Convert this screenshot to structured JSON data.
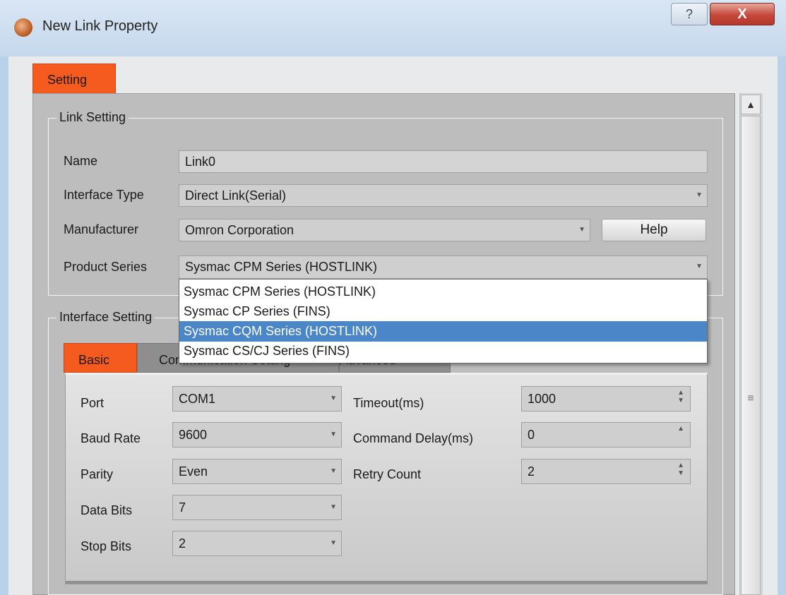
{
  "window": {
    "title": "New Link Property",
    "help_button": "?",
    "close_button": "X"
  },
  "tabs": {
    "setting": "Setting"
  },
  "link_setting": {
    "legend": "Link Setting",
    "name_label": "Name",
    "name_value": "Link0",
    "interface_type_label": "Interface Type",
    "interface_type_value": "Direct Link(Serial)",
    "manufacturer_label": "Manufacturer",
    "manufacturer_value": "Omron Corporation",
    "help_label": "Help",
    "product_series_label": "Product Series",
    "product_series_value": "Sysmac CPM Series (HOSTLINK)"
  },
  "product_series_options": [
    {
      "label": "Sysmac CPM Series (HOSTLINK)",
      "selected": false
    },
    {
      "label": "Sysmac CP Series (FINS)",
      "selected": false
    },
    {
      "label": "Sysmac CQM Series (HOSTLINK)",
      "selected": true
    },
    {
      "label": "Sysmac CS/CJ Series (FINS)",
      "selected": false
    }
  ],
  "interface_setting": {
    "legend": "Interface Setting",
    "tabs": {
      "basic": "Basic",
      "comm": "Communication Setting",
      "advanced": "Advanced"
    },
    "port_label": "Port",
    "port_value": "COM1",
    "baud_label": "Baud Rate",
    "baud_value": "9600",
    "parity_label": "Parity",
    "parity_value": "Even",
    "data_bits_label": "Data Bits",
    "data_bits_value": "7",
    "stop_bits_label": "Stop Bits",
    "stop_bits_value": "2",
    "timeout_label": "Timeout(ms)",
    "timeout_value": "1000",
    "command_delay_label": "Command Delay(ms)",
    "command_delay_value": "0",
    "retry_label": "Retry Count",
    "retry_value": "2"
  },
  "colors": {
    "accent": "#f55a1f",
    "selection": "#4a86c8"
  }
}
